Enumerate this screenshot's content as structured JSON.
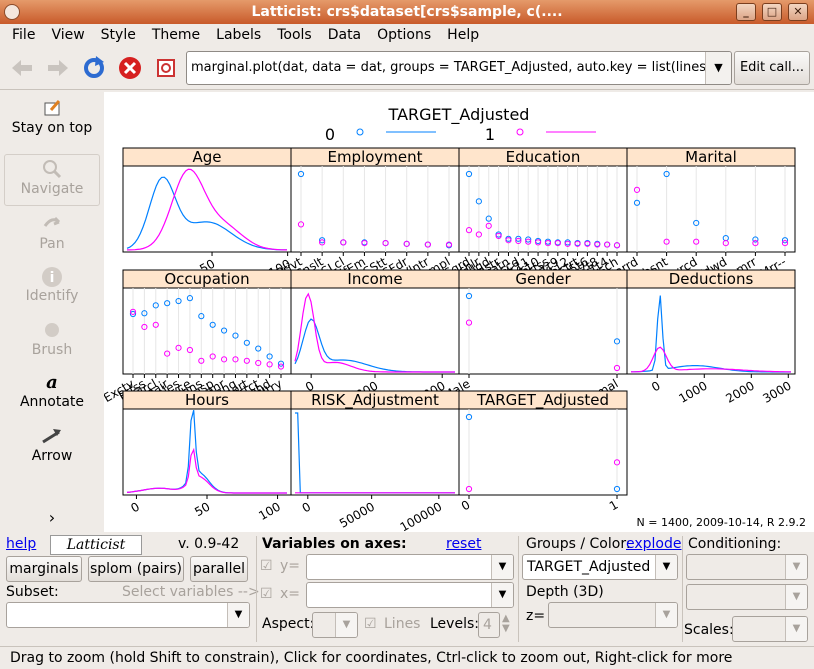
{
  "window": {
    "title": "Latticist: crs$dataset[crs$sample, c(...."
  },
  "window_buttons": [
    "_",
    "□",
    "✕"
  ],
  "menu": [
    "File",
    "View",
    "Style",
    "Theme",
    "Labels",
    "Tools",
    "Data",
    "Options",
    "Help"
  ],
  "toolbar": {
    "call_text": "marginal.plot(dat, data = dat, groups = TARGET_Adjusted, auto.key = list(lines = TRUE), ...",
    "edit_call_label": "Edit call..."
  },
  "left_tools": [
    {
      "label": "Stay on top",
      "icon": "pin-icon",
      "enabled": true
    },
    {
      "label": "Navigate",
      "icon": "zoom-icon",
      "enabled": false
    },
    {
      "label": "Pan",
      "icon": "pan-icon",
      "enabled": false
    },
    {
      "label": "Identify",
      "icon": "info-icon",
      "enabled": false
    },
    {
      "label": "Brush",
      "icon": "brush-icon",
      "enabled": false
    },
    {
      "label": "Annotate",
      "icon": "annotate-icon",
      "enabled": true
    },
    {
      "label": "Arrow",
      "icon": "arrow-icon",
      "enabled": true
    }
  ],
  "more_chevron": "›",
  "plot": {
    "legend_title": "TARGET_Adjusted",
    "legend_entries": [
      {
        "name": "0",
        "color": "#0080ff"
      },
      {
        "name": "1",
        "color": "#ff00ff"
      }
    ],
    "footnote": "N = 1400, 2009-10-14, R 2.9.2"
  },
  "chart_data": {
    "type": "line",
    "panels": [
      {
        "strip": "Age",
        "kind": "density",
        "ticks": [
          "50",
          "100"
        ]
      },
      {
        "strip": "Employment",
        "kind": "dots",
        "ticks": [
          "Privt",
          "Cnslt",
          "PSLcl",
          "SlfEm",
          "PSStt",
          "PSFdr",
          "Vlntr",
          "Unmpl"
        ],
        "s0": [
          1.0,
          0.08,
          0.05,
          0.05,
          0.04,
          0.03,
          0.02,
          0.01
        ],
        "s1": [
          0.3,
          0.05,
          0.05,
          0.04,
          0.04,
          0.03,
          0.02,
          0.02
        ]
      },
      {
        "strip": "Education",
        "kind": "dots",
        "ticks": [
          "HSgrd",
          "Bchlr",
          "Cllgd",
          "Mastr",
          "Vcatn",
          "Asscd",
          "Yr11",
          "Yr10",
          "Prfss",
          "Yr9",
          "Yr12",
          "Dctrt",
          "Yr5t6",
          "Yr7t8",
          "Yr1t4",
          "Prsch"
        ],
        "s0": [
          1.0,
          0.62,
          0.38,
          0.16,
          0.1,
          0.1,
          0.09,
          0.07,
          0.06,
          0.05,
          0.05,
          0.04,
          0.04,
          0.03,
          0.02,
          0.01
        ],
        "s1": [
          0.22,
          0.16,
          0.28,
          0.14,
          0.08,
          0.07,
          0.06,
          0.05,
          0.04,
          0.04,
          0.03,
          0.03,
          0.03,
          0.02,
          0.02,
          0.01
        ]
      },
      {
        "strip": "Marital",
        "kind": "dots",
        "ticks": [
          "Marrd",
          "Absnt",
          "Dvrcd",
          "Wdwd",
          "Unmrr",
          "Mrr--"
        ],
        "s0": [
          0.6,
          1.0,
          0.32,
          0.11,
          0.09,
          0.08
        ],
        "s1": [
          0.78,
          0.06,
          0.06,
          0.04,
          0.04,
          0.04
        ]
      },
      {
        "strip": "Occupation",
        "kind": "dots",
        "ticks": [
          "Exctv",
          "Prfss",
          "Clrcl",
          "Rpair",
          "Sales",
          "Srvce",
          "Mchns",
          "Trnsp",
          "Cleanr",
          "Frmng",
          "Sport",
          "Prtct",
          "Hsehd",
          "Mltry"
        ],
        "s0": [
          0.75,
          0.76,
          0.87,
          0.9,
          0.93,
          0.97,
          0.72,
          0.6,
          0.52,
          0.45,
          0.35,
          0.27,
          0.16,
          0.06
        ],
        "s1": [
          0.78,
          0.57,
          0.6,
          0.2,
          0.28,
          0.25,
          0.1,
          0.16,
          0.12,
          0.12,
          0.1,
          0.07,
          0.05,
          0.02
        ]
      },
      {
        "strip": "Income",
        "kind": "density",
        "ticks": [
          "0",
          "20000",
          "40000"
        ]
      },
      {
        "strip": "Gender",
        "kind": "dots",
        "ticks": [
          "Male",
          "Femal"
        ],
        "s0": [
          1.0,
          0.37
        ],
        "s1": [
          0.63,
          0.0
        ]
      },
      {
        "strip": "Deductions",
        "kind": "density",
        "ticks": [
          "0",
          "1000",
          "2000",
          "3000"
        ]
      },
      {
        "strip": "Hours",
        "kind": "density",
        "ticks": [
          "0",
          "50",
          "100"
        ]
      },
      {
        "strip": "RISK_Adjustment",
        "kind": "density",
        "ticks": [
          "0",
          "50000",
          "100000"
        ]
      },
      {
        "strip": "TARGET_Adjusted",
        "kind": "dots",
        "ticks": [
          "0",
          "1"
        ],
        "s0": [
          1.0,
          0.0
        ],
        "s1": [
          0.0,
          0.37
        ]
      }
    ]
  },
  "bottom": {
    "help_label": "help",
    "logo_text": "Latticist",
    "version": "v. 0.9-42",
    "marginals_label": "marginals",
    "splom_label": "splom (pairs)",
    "parallel_label": "parallel",
    "subset_label": "Subset:",
    "select_vars_label": "Select variables -->",
    "vars_on_axes_label": "Variables on axes:",
    "reset_label": "reset",
    "y_label": "y=",
    "x_label": "x=",
    "aspect_label": "Aspect:",
    "lines_label": "Lines",
    "levels_label": "Levels:",
    "levels_value": "4",
    "groups_label": "Groups / Color:",
    "explode_label": "explode",
    "groups_value": "TARGET_Adjusted",
    "depth_label": "Depth (3D)",
    "z_label": "z=",
    "conditioning_label": "Conditioning:",
    "scales_label": "Scales:"
  },
  "status": "Drag to zoom (hold Shift to constrain), Click for coordinates, Ctrl-click to zoom out, Right-click for more"
}
